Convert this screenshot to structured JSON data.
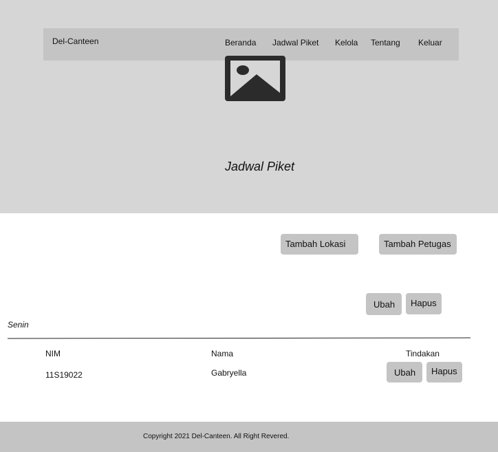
{
  "navbar": {
    "brand": "Del-Canteen",
    "links": [
      "Beranda",
      "Jadwal Piket",
      "Kelola",
      "Tentang",
      "Keluar"
    ]
  },
  "hero": {
    "image_icon": "image-placeholder-icon",
    "title": "Jadwal Piket"
  },
  "actions": {
    "add_location": "Tambah Lokasi",
    "add_officer": "Tambah  Petugas",
    "edit": "Ubah",
    "delete": "Hapus"
  },
  "schedule": {
    "day": "Senin",
    "columns": [
      "NIM",
      "Nama",
      "Tindakan"
    ],
    "rows": [
      {
        "nim": "11S19022",
        "nama": "Gabryella",
        "edit": "Ubah",
        "delete": "Hapus"
      }
    ]
  },
  "footer": {
    "copyright": "Copyright 2021 Del-Canteen. All Right Revered."
  },
  "colors": {
    "hero_bg": "#d6d6d6",
    "navbar_bg": "#c4c4c4",
    "button_bg": "#c4c4c4",
    "footer_bg": "#c4c4c4"
  }
}
